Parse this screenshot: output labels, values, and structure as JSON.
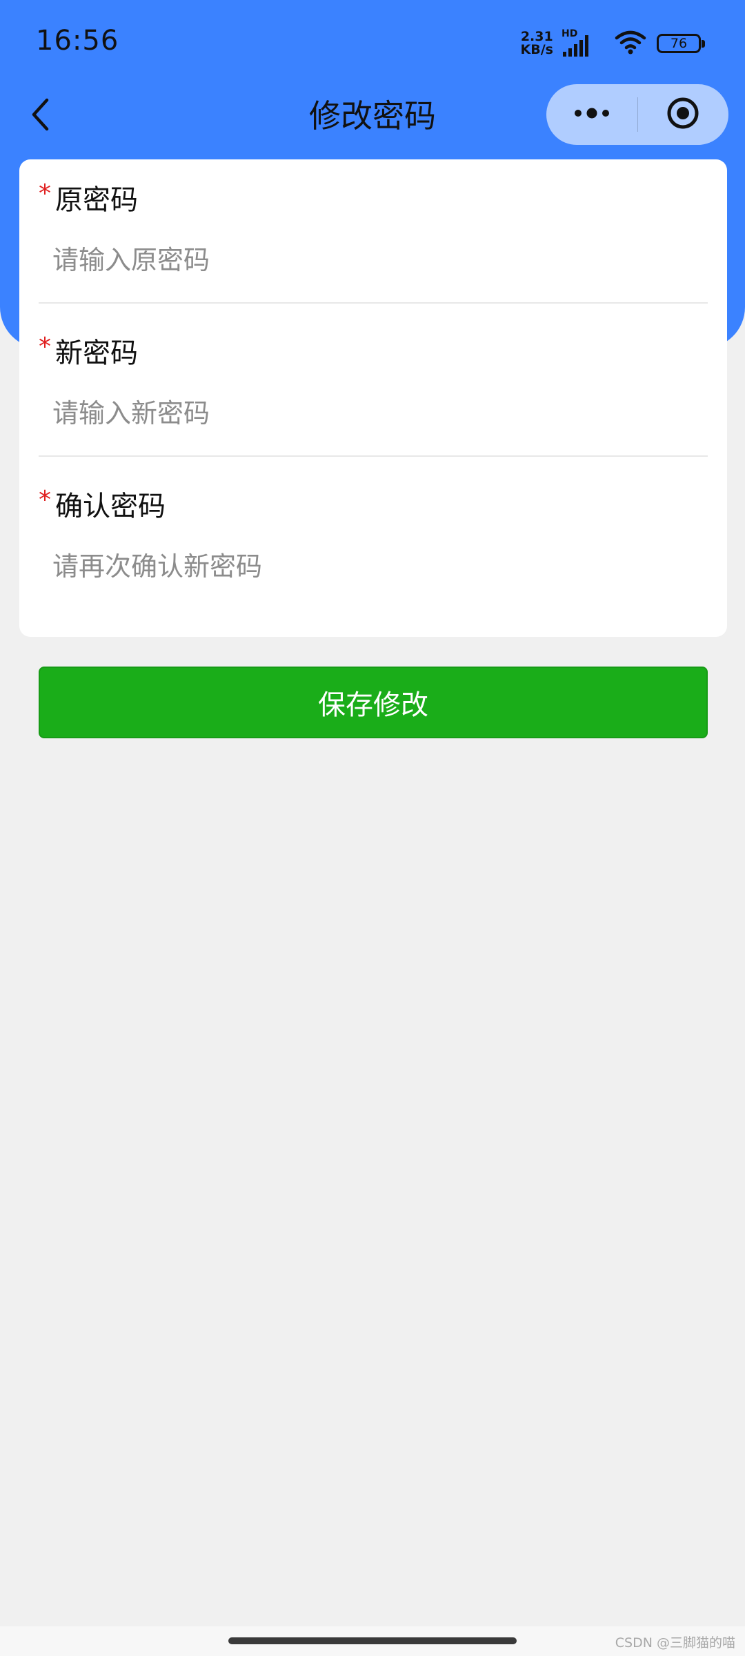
{
  "status_bar": {
    "time": "16:56",
    "net_speed_value": "2.31",
    "net_speed_unit": "KB/s",
    "network_label": "HD",
    "battery_level": "76",
    "icons": [
      "signal-icon",
      "wifi-icon",
      "battery-icon"
    ]
  },
  "nav": {
    "title": "修改密码",
    "back_icon": "chevron-left-icon",
    "menu_icon": "more-dots-icon",
    "close_icon": "target-circle-icon"
  },
  "form": {
    "required_mark": "*",
    "fields": [
      {
        "label": "原密码",
        "placeholder": "请输入原密码",
        "value": ""
      },
      {
        "label": "新密码",
        "placeholder": "请输入新密码",
        "value": ""
      },
      {
        "label": "确认密码",
        "placeholder": "请再次确认新密码",
        "value": ""
      }
    ]
  },
  "actions": {
    "save_label": "保存修改"
  },
  "footer": {
    "watermark": "CSDN @三脚猫的喵"
  },
  "colors": {
    "header_blue": "#3b82ff",
    "save_green": "#1aad19",
    "required_red": "#e02020",
    "page_background": "#f0f0f0"
  }
}
